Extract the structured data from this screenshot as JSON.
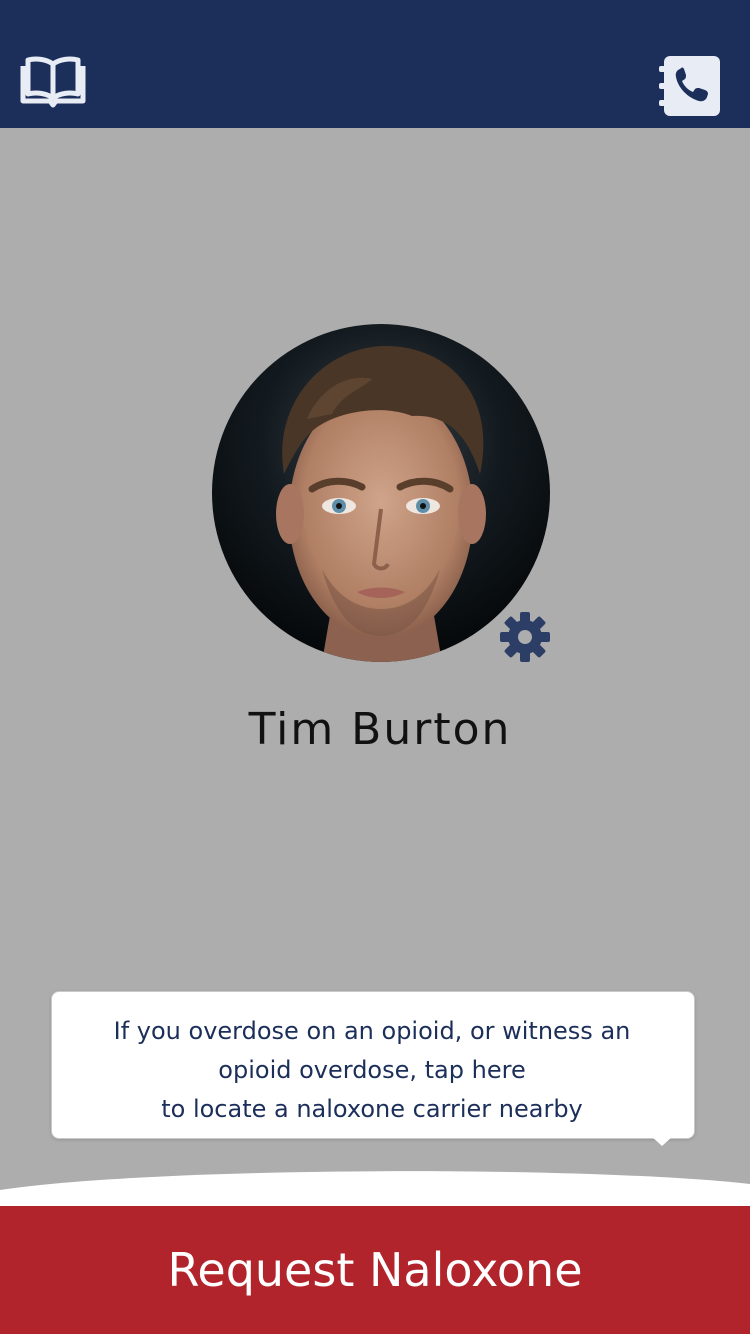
{
  "header": {
    "left_icon": "book-icon",
    "right_icon": "phone-contacts-icon",
    "bar_color": "#1c2f5a"
  },
  "profile": {
    "name": "Tim Burton",
    "photo": "avatar-photo",
    "settings_icon": "gear-icon"
  },
  "tooltip": {
    "line1": "If you overdose on an opioid, or witness an",
    "line2": "opioid overdose, tap here",
    "line3": "to locate a naloxone carrier nearby"
  },
  "action": {
    "request_label": "Request Naloxone",
    "color": "#b2242b"
  }
}
